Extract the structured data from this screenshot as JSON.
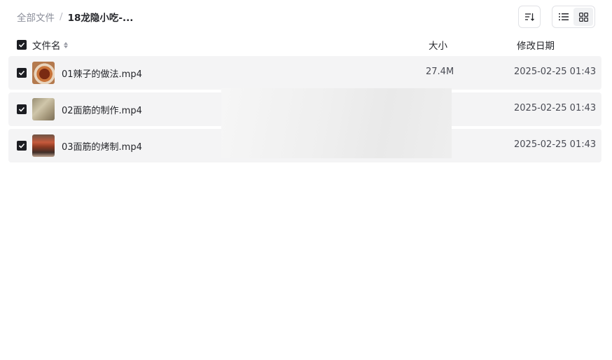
{
  "breadcrumb": {
    "root": "全部文件",
    "separator": "/",
    "current": "18龙隐小吃-..."
  },
  "toolbar": {
    "sort_icon": "sort-lines-icon",
    "list_view_icon": "list-view-icon",
    "grid_view_icon": "grid-view-icon",
    "active_view": "grid"
  },
  "table": {
    "headers": {
      "name": "文件名",
      "size": "大小",
      "modified": "修改日期"
    },
    "rows": [
      {
        "name": "01辣子的做法.mp4",
        "size": "27.4M",
        "modified": "2025-02-25 01:43",
        "checked": true
      },
      {
        "name": "02面筋的制作.mp4",
        "size": "",
        "modified": "2025-02-25 01:43",
        "checked": true
      },
      {
        "name": "03面筋的烤制.mp4",
        "size": "",
        "modified": "2025-02-25 01:43",
        "checked": true
      }
    ]
  },
  "colors": {
    "row_bg": "#f4f4f5",
    "checkbox": "#1c1d22",
    "muted_text": "#8a8d99"
  }
}
